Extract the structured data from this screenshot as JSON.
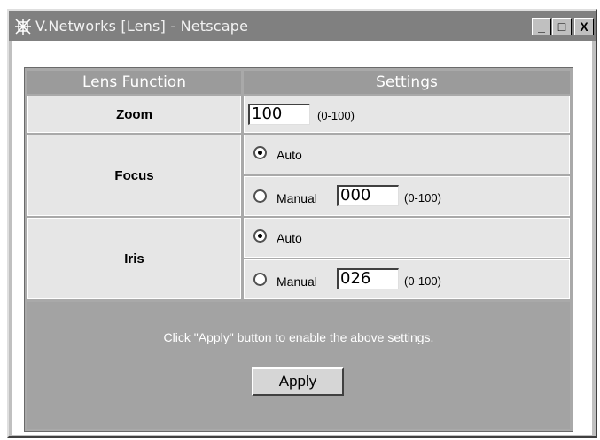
{
  "window": {
    "title": "V.Networks [Lens] - Netscape",
    "controls": {
      "minimize": "_",
      "maximize": "□",
      "close": "X"
    }
  },
  "table": {
    "header_function": "Lens Function",
    "header_settings": "Settings"
  },
  "zoom": {
    "label": "Zoom",
    "value": "100",
    "range": "(0-100)"
  },
  "focus": {
    "label": "Focus",
    "auto_label": "Auto",
    "manual_label": "Manual",
    "selected": "Auto",
    "manual_value": "000",
    "range": "(0-100)"
  },
  "iris": {
    "label": "Iris",
    "auto_label": "Auto",
    "manual_label": "Manual",
    "selected": "Auto",
    "manual_value": "026",
    "range": "(0-100)"
  },
  "footer": {
    "message": "Click \"Apply\" button to enable the above settings.",
    "apply_label": "Apply"
  }
}
